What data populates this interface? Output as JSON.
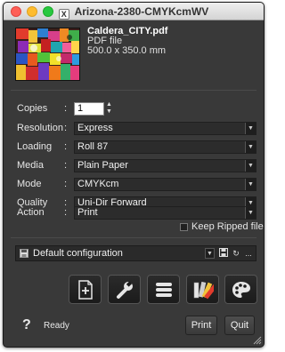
{
  "window": {
    "title": "Arizona-2380-CMYKcmWV"
  },
  "file": {
    "name": "Caldera_CITY.pdf",
    "type": "PDF file",
    "size": "500.0 x 350.0 mm"
  },
  "settings": {
    "copies": {
      "label": "Copies",
      "value": "1"
    },
    "resolution": {
      "label": "Resolution",
      "value": "Express"
    },
    "loading": {
      "label": "Loading",
      "value": "Roll 87"
    },
    "media": {
      "label": "Media",
      "value": "Plain Paper"
    },
    "mode": {
      "label": "Mode",
      "value": "CMYKcm"
    },
    "quality": {
      "label": "Quality",
      "value": "Uni-Dir Forward"
    },
    "action": {
      "label": "Action",
      "value": "Print"
    },
    "colon": ":"
  },
  "keep_ripped": {
    "label": "Keep Ripped file",
    "checked": false
  },
  "config": {
    "value": "Default configuration",
    "more_label": "..."
  },
  "toolbar": {
    "icons": [
      "add-page-icon",
      "wrench-icon",
      "list-icon",
      "color-swatch-icon",
      "palette-icon"
    ]
  },
  "footer": {
    "help": "?",
    "status": "Ready",
    "print_label": "Print",
    "quit_label": "Quit"
  },
  "colors": {
    "window_bg": "#393939",
    "titlebar": "#e2e2e2",
    "field_bg": "#2c2c2c"
  }
}
